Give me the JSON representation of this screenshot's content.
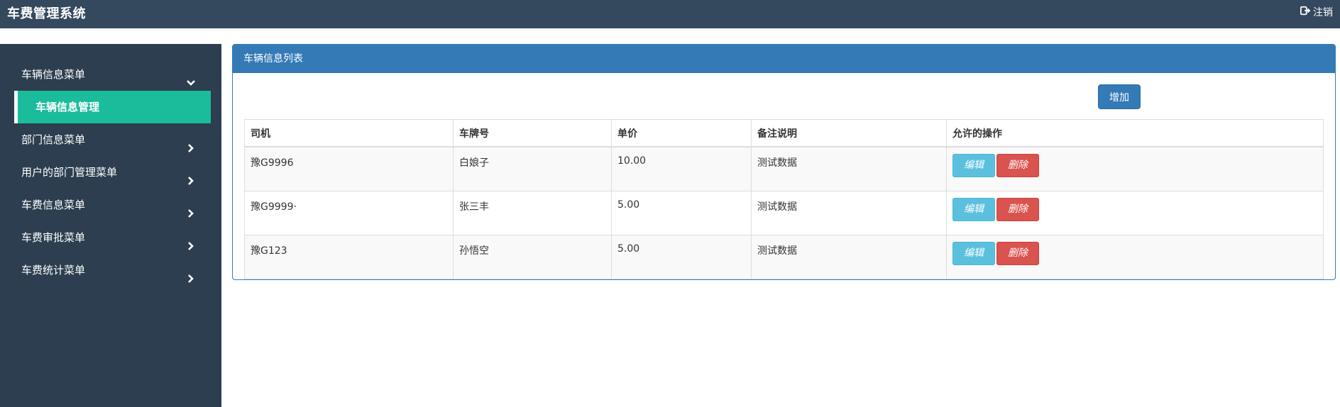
{
  "header": {
    "title": "车费管理系统",
    "logout_label": "注销"
  },
  "sidebar": {
    "items": [
      {
        "label": "车辆信息菜单",
        "expanded": true,
        "icon": "chevron-down-icon"
      },
      {
        "label": "部门信息菜单",
        "icon": "chevron-right-icon"
      },
      {
        "label": "用户的部门管理菜单",
        "icon": "chevron-right-icon"
      },
      {
        "label": "车费信息菜单",
        "icon": "chevron-right-icon"
      },
      {
        "label": "车费审批菜单",
        "icon": "chevron-right-icon"
      },
      {
        "label": "车费统计菜单",
        "icon": "chevron-right-icon"
      }
    ],
    "active_subitem": "车辆信息管理"
  },
  "panel": {
    "title": "车辆信息列表",
    "add_label": "增加"
  },
  "table": {
    "columns": [
      "司机",
      "车牌号",
      "单价",
      "备注说明",
      "允许的操作"
    ],
    "rows": [
      {
        "driver": "豫G9996",
        "plate": "白娘子",
        "price": "10.00",
        "note": "测试数据"
      },
      {
        "driver": "豫G9999·",
        "plate": "张三丰",
        "price": "5.00",
        "note": "测试数据"
      },
      {
        "driver": "豫G123",
        "plate": "孙悟空",
        "price": "5.00",
        "note": "测试数据"
      }
    ],
    "edit_label": "编辑",
    "delete_label": "删除"
  },
  "colors": {
    "topbar": "#34495e",
    "sidebar": "#2c3e50",
    "active": "#1abc9c",
    "primary": "#337ab7",
    "info": "#5bc0de",
    "danger": "#d9534f"
  }
}
